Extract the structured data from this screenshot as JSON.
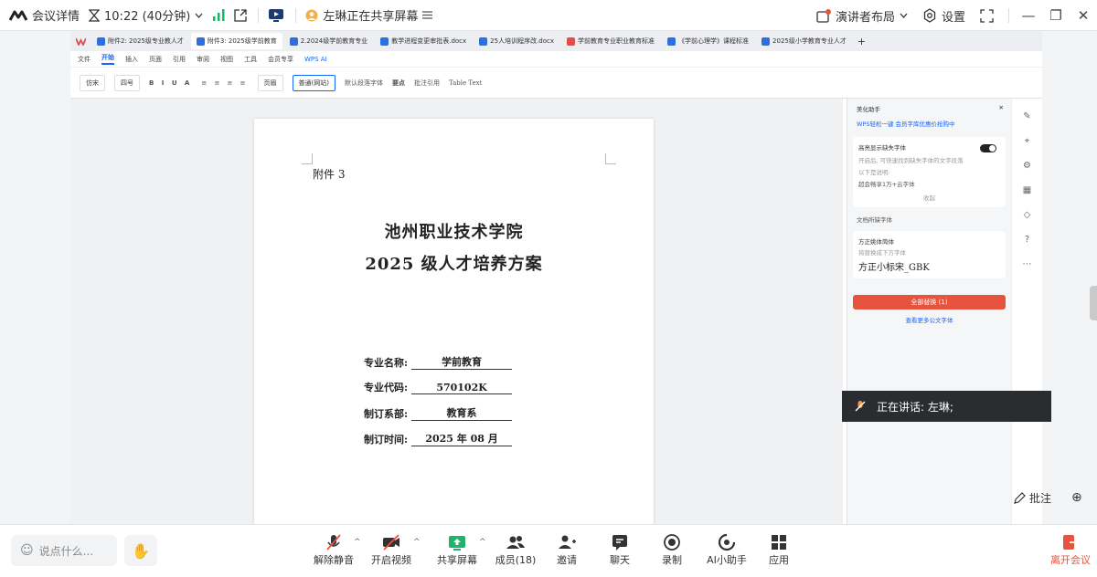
{
  "meeting_bar": {
    "details_label": "会议详情",
    "time_label": "10:22 (40分钟)",
    "sharing_label": "左琳正在共享屏幕",
    "layout_label": "演讲者布局",
    "settings_label": "设置"
  },
  "wps": {
    "tabs": [
      "附件2: 2025级专业教人才",
      "附件3: 2025级学前教育",
      "2.2024级学前教育专业",
      "教学进程变更审批表.docx",
      "25人培训程序改.docx",
      "学前教育专业职业教育标准",
      "《学前心理学》课程标准",
      "2025级小学教育专业人才"
    ],
    "menu": [
      "文件",
      "开始",
      "插入",
      "页面",
      "引用",
      "审阅",
      "视图",
      "工具",
      "会员专享",
      "WPS AI"
    ],
    "active_menu": "开始",
    "font_name": "仿宋",
    "font_size": "四号",
    "styles": [
      "页眉",
      "普通(网站)",
      "默认段落字体",
      "要点",
      "批注引用",
      "Table Text"
    ]
  },
  "document": {
    "attachment": "附件 3",
    "title_line1": "池州职业技术学院",
    "title_line2": "2025 级人才培养方案",
    "fields": [
      {
        "label": "专业名称:",
        "value": "学前教育"
      },
      {
        "label": "专业代码:",
        "value": "570102K"
      },
      {
        "label": "制订系部:",
        "value": "教育系"
      },
      {
        "label": "制订时间:",
        "value": "2025 年 08 月"
      }
    ]
  },
  "side_panel": {
    "title": "美化助手",
    "promo": "WPS轻松一键 会员字库优惠价抢购中",
    "missing_font_heading": "高亮显示缺失字体",
    "missing_font_desc": "开启后, 可快速找到缺失字体的文字段落",
    "missing_font_desc2": "以下是说明:",
    "font_count": "超会畅享1万+云字体",
    "collapse": "收起",
    "doc_fonts_heading": "文档所缺字体",
    "font_from": "方正姚体简体",
    "replace_hint": "将替换成下方字体",
    "font_to": "方正小标宋_GBK",
    "replace_all_button": "全部替换 (1)",
    "more_fonts": "查看更多公文字体"
  },
  "speaker": {
    "label": "正在讲话:",
    "name": "左琳;"
  },
  "annotate_label": "批注",
  "bottom_bar": {
    "say_placeholder": "说点什么...",
    "buttons": [
      "解除静音",
      "开启视频",
      "共享屏幕",
      "成员(18)",
      "邀请",
      "聊天",
      "录制",
      "AI小助手",
      "应用"
    ],
    "leave_label": "离开会议"
  },
  "colors": {
    "accent": "#1664ff",
    "danger": "#e8533e",
    "share_green": "#1fb36b"
  }
}
